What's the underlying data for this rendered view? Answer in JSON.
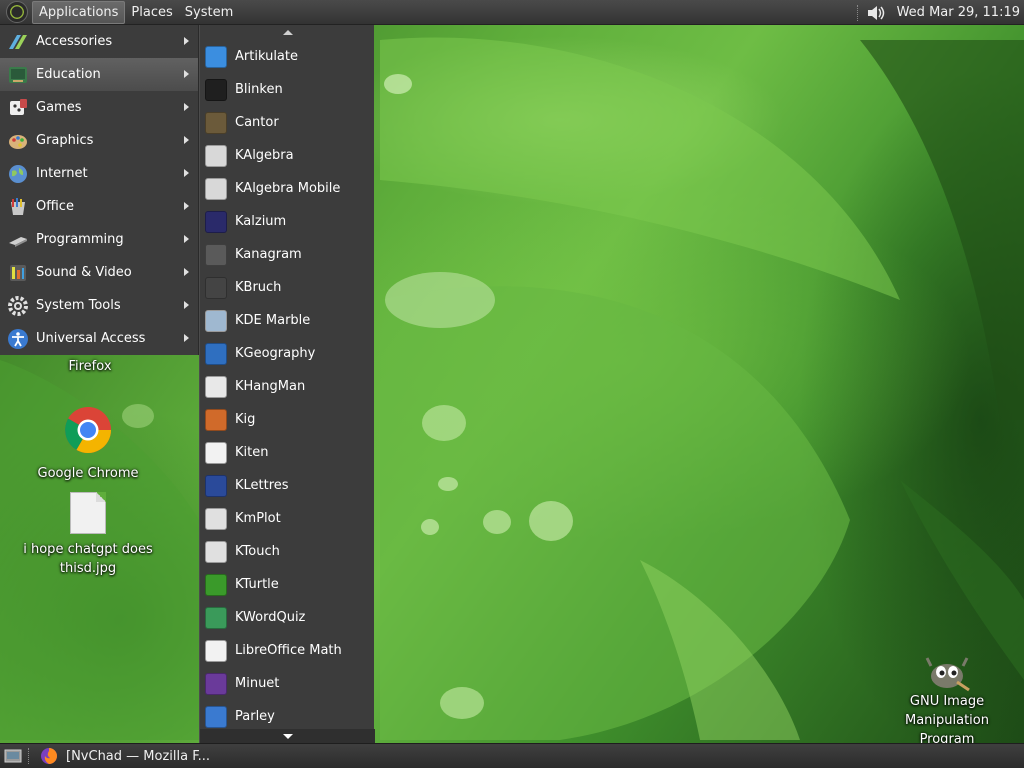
{
  "top_panel": {
    "menus": [
      {
        "label": "Applications"
      },
      {
        "label": "Places"
      },
      {
        "label": "System"
      }
    ],
    "clock": "Wed Mar 29, 11:19",
    "volume_icon": "speaker-icon"
  },
  "applications_menu": {
    "selected": "Education",
    "categories": [
      {
        "label": "Accessories",
        "icon": "accessories-icon"
      },
      {
        "label": "Education",
        "icon": "education-icon"
      },
      {
        "label": "Games",
        "icon": "games-icon"
      },
      {
        "label": "Graphics",
        "icon": "graphics-icon"
      },
      {
        "label": "Internet",
        "icon": "internet-icon"
      },
      {
        "label": "Office",
        "icon": "office-icon"
      },
      {
        "label": "Programming",
        "icon": "programming-icon"
      },
      {
        "label": "Sound & Video",
        "icon": "sound-video-icon"
      },
      {
        "label": "System Tools",
        "icon": "system-tools-icon"
      },
      {
        "label": "Universal Access",
        "icon": "universal-access-icon"
      }
    ]
  },
  "education_submenu": {
    "items": [
      {
        "label": "Artikulate",
        "icon": "artikulate-icon",
        "color": "#3b8ee0"
      },
      {
        "label": "Blinken",
        "icon": "blinken-icon",
        "color": "#1f1f1f"
      },
      {
        "label": "Cantor",
        "icon": "cantor-icon",
        "color": "#6b5a3a"
      },
      {
        "label": "KAlgebra",
        "icon": "kalgebra-icon",
        "color": "#d8d8d8"
      },
      {
        "label": "KAlgebra Mobile",
        "icon": "kalgebra-mobile-icon",
        "color": "#d8d8d8"
      },
      {
        "label": "Kalzium",
        "icon": "kalzium-icon",
        "color": "#2a2a6a"
      },
      {
        "label": "Kanagram",
        "icon": "kanagram-icon",
        "color": "#5a5a5a"
      },
      {
        "label": "KBruch",
        "icon": "kbruch-icon",
        "color": "#444444"
      },
      {
        "label": "KDE Marble",
        "icon": "marble-icon",
        "color": "#9fb8d0"
      },
      {
        "label": "KGeography",
        "icon": "kgeography-icon",
        "color": "#2f6fc0"
      },
      {
        "label": "KHangMan",
        "icon": "khangman-icon",
        "color": "#e8e8e8"
      },
      {
        "label": "Kig",
        "icon": "kig-icon",
        "color": "#d06a2a"
      },
      {
        "label": "Kiten",
        "icon": "kiten-icon",
        "color": "#f2f2f2"
      },
      {
        "label": "KLettres",
        "icon": "klettres-icon",
        "color": "#2a4a9a"
      },
      {
        "label": "KmPlot",
        "icon": "kmplot-icon",
        "color": "#e0e0e0"
      },
      {
        "label": "KTouch",
        "icon": "ktouch-icon",
        "color": "#e0e0e0"
      },
      {
        "label": "KTurtle",
        "icon": "kturtle-icon",
        "color": "#3a9a2a"
      },
      {
        "label": "KWordQuiz",
        "icon": "kwordquiz-icon",
        "color": "#3a9a5a"
      },
      {
        "label": "LibreOffice Math",
        "icon": "libreoffice-math-icon",
        "color": "#f2f2f2"
      },
      {
        "label": "Minuet",
        "icon": "minuet-icon",
        "color": "#6a3a9a"
      },
      {
        "label": "Parley",
        "icon": "parley-icon",
        "color": "#3a7ad0"
      }
    ]
  },
  "desktop": {
    "icons": [
      {
        "label": "Firefox"
      },
      {
        "label": "Google Chrome"
      },
      {
        "label_line1": "i hope chatgpt does",
        "label_line2": "thisd.jpg"
      },
      {
        "label_line1": "GNU Image",
        "label_line2": "Manipulation",
        "label_line3": "Program"
      }
    ]
  },
  "bottom_panel": {
    "task": {
      "label": "[NvChad — Mozilla F...",
      "icon": "firefox-icon"
    }
  }
}
